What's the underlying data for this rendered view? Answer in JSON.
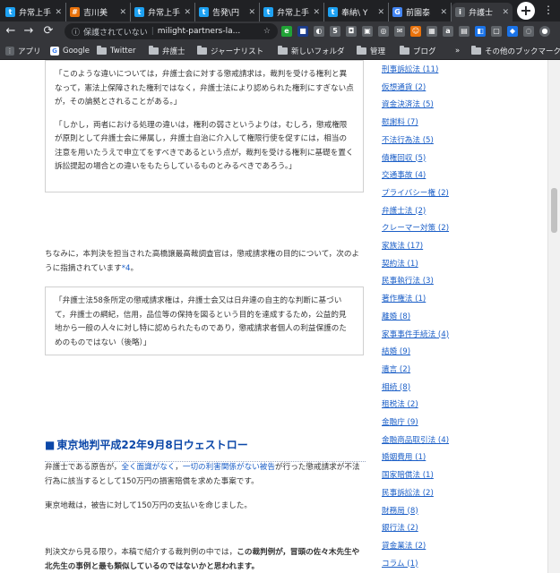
{
  "browser": {
    "tabs": [
      {
        "title": "弁常上手",
        "favicon_color": "#1da1f2",
        "favicon_glyph": "t",
        "active": false
      },
      {
        "title": "吉川美",
        "favicon_color": "#e8710a",
        "favicon_glyph": "#",
        "active": false
      },
      {
        "title": "弁常上手",
        "favicon_color": "#1da1f2",
        "favicon_glyph": "t",
        "active": false
      },
      {
        "title": "告発\\円",
        "favicon_color": "#1da1f2",
        "favicon_glyph": "t",
        "active": false
      },
      {
        "title": "弁常上手",
        "favicon_color": "#1da1f2",
        "favicon_glyph": "t",
        "active": false
      },
      {
        "title": "奉納\\ Y",
        "favicon_color": "#1da1f2",
        "favicon_glyph": "t",
        "active": false
      },
      {
        "title": "前園泰",
        "favicon_color": "#4285f4",
        "favicon_glyph": "G",
        "active": false
      },
      {
        "title": "弁護士",
        "favicon_color": "#5f6368",
        "favicon_glyph": "i",
        "active": true
      }
    ],
    "new_tab": "+",
    "menu": "⋮",
    "back": "←",
    "forward": "→",
    "reload": "⟳",
    "security_label": "保護されていない",
    "url": "milight-partners-la...",
    "star": "☆",
    "bookmarks": [
      {
        "label": "アプリ",
        "type": "apps"
      },
      {
        "label": "Google",
        "type": "google"
      },
      {
        "label": "Twitter",
        "type": "folder"
      },
      {
        "label": "弁護士",
        "type": "folder"
      },
      {
        "label": "ジャーナリスト",
        "type": "folder"
      },
      {
        "label": "新しいフォルダ",
        "type": "folder"
      },
      {
        "label": "管理",
        "type": "folder"
      },
      {
        "label": "ブログ",
        "type": "folder"
      }
    ],
    "bookmarks_overflow": "»",
    "other_bookmarks": "その他のブックマーク"
  },
  "article": {
    "quote1_p1": "「このような違いについては，弁護士会に対する懲戒請求は，裁判を受ける権利と異なって，憲法上保障された権利ではなく，弁護士法により認められた権利にすぎない点が，その論拠とされることがある。」",
    "quote1_p2": "「しかし，両者における処理の違いは，権利の弱さというよりは，むしろ，懲戒権限が原則として弁護士会に帰属し，弁護士自治に介入して権限行使を促すには，相当の注意を用いたうえで申立てをすべきであるという点が，裁判を受ける権利に基礎を置く訴訟提起の場合との違いをもたらしているものとみるべきであろう。」",
    "para1_text": "ちなみに，本判決を担当された高橋譲最高裁調査官は，懲戒請求権の目的について，次のように指摘されています",
    "para1_footnote": "*4",
    "para1_end": "。",
    "quote2": "「弁護士法58条所定の懲戒請求権は，弁護士会又は日弁連の自主的な判断に基づいて，弁護士の綱紀，信用，品位等の保持を図るという目的を達成するため，公益的見地から一般の人々に対し特に認められたものであり，懲戒請求者個人の利益保護のためのものではない（後略）」",
    "heading_marker": "■",
    "heading": "東京地判平成22年9月8日ウェストロー",
    "para2_a": "弁護士である原告が，",
    "para2_link1": "全く面識がなく",
    "para2_b": "，",
    "para2_link2": "一切の利害関係がない被告",
    "para2_c": "が行った懲戒請求が不法行為に該当するとして150万円の損害賠償を求めた事案です。",
    "para3": "東京地裁は，被告に対して150万円の支払いを命じました。",
    "para4_a": "判決文から見る限り，本稿で紹介する裁判例の中では，",
    "para4_bold": "この裁判例が，冒頭の佐々木先生や北先生の事例と最も類似しているのではないかと思われます。"
  },
  "sidebar": {
    "categories": [
      "刑事訴訟法 (11)",
      "仮想通貨 (2)",
      "資金決済法 (5)",
      "慰謝料 (7)",
      "不法行為法 (5)",
      "債権回収 (5)",
      "交通事故 (4)",
      "プライバシー権 (2)",
      "弁護士法 (2)",
      "クレーマー対策 (2)",
      "家族法 (17)",
      "契約法 (1)",
      "民事執行法 (3)",
      "著作権法 (1)",
      "離婚 (8)",
      "家事事件手続法 (4)",
      "結婚 (9)",
      "遺言 (2)",
      "相続 (8)",
      "租税法 (2)",
      "金融庁 (9)",
      "金融商品取引法 (4)",
      "婚姻費用 (1)",
      "国家賠償法 (1)",
      "民事訴訟法 (2)",
      "財務局 (8)",
      "銀行法 (2)",
      "貸金業法 (2)",
      "コラム (1)"
    ]
  }
}
